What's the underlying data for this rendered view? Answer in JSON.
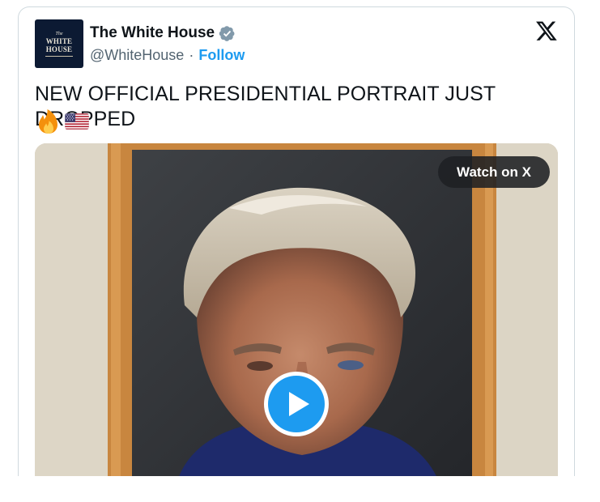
{
  "account": {
    "avatar_text": {
      "the": "The",
      "line1": "WHITE",
      "line2": "HOUSE",
      "small": "WASHINGTON"
    },
    "display_name": "The White House",
    "handle": "@WhiteHouse",
    "separator": "·",
    "follow_label": "Follow",
    "verified_badge_icon": "verified-badge-icon"
  },
  "header": {
    "platform_logo_icon": "x-logo-icon"
  },
  "tweet": {
    "text": "NEW OFFICIAL PRESIDENTIAL PORTRAIT JUST DROPPED",
    "emojis": [
      "fire-emoji",
      "us-flag-emoji"
    ]
  },
  "media": {
    "type": "video",
    "watch_label": "Watch on X",
    "play_icon": "play-icon"
  },
  "colors": {
    "link_blue": "#1d9bf0",
    "text": "#0f1419",
    "secondary_text": "#536471",
    "border": "#cfd9de",
    "watch_pill": "#1e2023"
  }
}
